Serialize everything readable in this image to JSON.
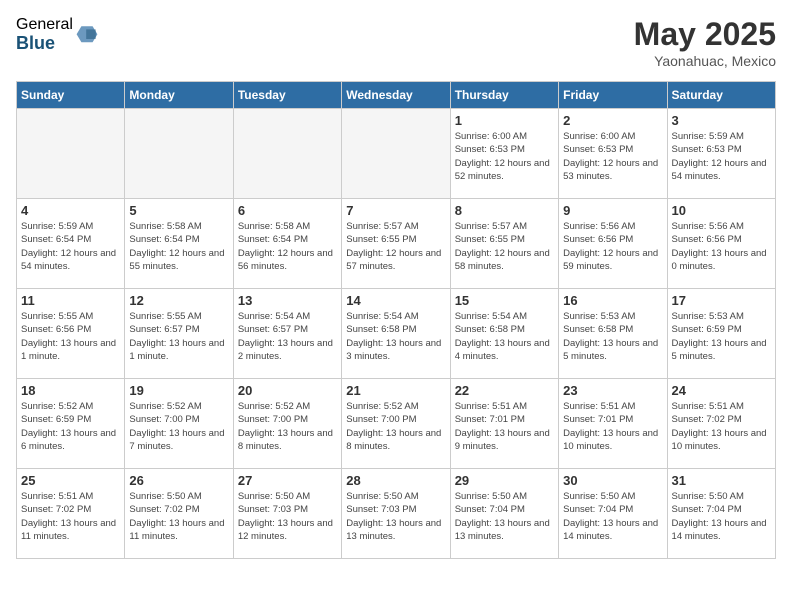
{
  "header": {
    "logo_general": "General",
    "logo_blue": "Blue",
    "month_title": "May 2025",
    "location": "Yaonahuac, Mexico"
  },
  "weekdays": [
    "Sunday",
    "Monday",
    "Tuesday",
    "Wednesday",
    "Thursday",
    "Friday",
    "Saturday"
  ],
  "weeks": [
    [
      {
        "day": "",
        "info": "",
        "empty": true
      },
      {
        "day": "",
        "info": "",
        "empty": true
      },
      {
        "day": "",
        "info": "",
        "empty": true
      },
      {
        "day": "",
        "info": "",
        "empty": true
      },
      {
        "day": "1",
        "info": "Sunrise: 6:00 AM\nSunset: 6:53 PM\nDaylight: 12 hours\nand 52 minutes."
      },
      {
        "day": "2",
        "info": "Sunrise: 6:00 AM\nSunset: 6:53 PM\nDaylight: 12 hours\nand 53 minutes."
      },
      {
        "day": "3",
        "info": "Sunrise: 5:59 AM\nSunset: 6:53 PM\nDaylight: 12 hours\nand 54 minutes."
      }
    ],
    [
      {
        "day": "4",
        "info": "Sunrise: 5:59 AM\nSunset: 6:54 PM\nDaylight: 12 hours\nand 54 minutes."
      },
      {
        "day": "5",
        "info": "Sunrise: 5:58 AM\nSunset: 6:54 PM\nDaylight: 12 hours\nand 55 minutes."
      },
      {
        "day": "6",
        "info": "Sunrise: 5:58 AM\nSunset: 6:54 PM\nDaylight: 12 hours\nand 56 minutes."
      },
      {
        "day": "7",
        "info": "Sunrise: 5:57 AM\nSunset: 6:55 PM\nDaylight: 12 hours\nand 57 minutes."
      },
      {
        "day": "8",
        "info": "Sunrise: 5:57 AM\nSunset: 6:55 PM\nDaylight: 12 hours\nand 58 minutes."
      },
      {
        "day": "9",
        "info": "Sunrise: 5:56 AM\nSunset: 6:56 PM\nDaylight: 12 hours\nand 59 minutes."
      },
      {
        "day": "10",
        "info": "Sunrise: 5:56 AM\nSunset: 6:56 PM\nDaylight: 13 hours\nand 0 minutes."
      }
    ],
    [
      {
        "day": "11",
        "info": "Sunrise: 5:55 AM\nSunset: 6:56 PM\nDaylight: 13 hours\nand 1 minute."
      },
      {
        "day": "12",
        "info": "Sunrise: 5:55 AM\nSunset: 6:57 PM\nDaylight: 13 hours\nand 1 minute."
      },
      {
        "day": "13",
        "info": "Sunrise: 5:54 AM\nSunset: 6:57 PM\nDaylight: 13 hours\nand 2 minutes."
      },
      {
        "day": "14",
        "info": "Sunrise: 5:54 AM\nSunset: 6:58 PM\nDaylight: 13 hours\nand 3 minutes."
      },
      {
        "day": "15",
        "info": "Sunrise: 5:54 AM\nSunset: 6:58 PM\nDaylight: 13 hours\nand 4 minutes."
      },
      {
        "day": "16",
        "info": "Sunrise: 5:53 AM\nSunset: 6:58 PM\nDaylight: 13 hours\nand 5 minutes."
      },
      {
        "day": "17",
        "info": "Sunrise: 5:53 AM\nSunset: 6:59 PM\nDaylight: 13 hours\nand 5 minutes."
      }
    ],
    [
      {
        "day": "18",
        "info": "Sunrise: 5:52 AM\nSunset: 6:59 PM\nDaylight: 13 hours\nand 6 minutes."
      },
      {
        "day": "19",
        "info": "Sunrise: 5:52 AM\nSunset: 7:00 PM\nDaylight: 13 hours\nand 7 minutes."
      },
      {
        "day": "20",
        "info": "Sunrise: 5:52 AM\nSunset: 7:00 PM\nDaylight: 13 hours\nand 8 minutes."
      },
      {
        "day": "21",
        "info": "Sunrise: 5:52 AM\nSunset: 7:00 PM\nDaylight: 13 hours\nand 8 minutes."
      },
      {
        "day": "22",
        "info": "Sunrise: 5:51 AM\nSunset: 7:01 PM\nDaylight: 13 hours\nand 9 minutes."
      },
      {
        "day": "23",
        "info": "Sunrise: 5:51 AM\nSunset: 7:01 PM\nDaylight: 13 hours\nand 10 minutes."
      },
      {
        "day": "24",
        "info": "Sunrise: 5:51 AM\nSunset: 7:02 PM\nDaylight: 13 hours\nand 10 minutes."
      }
    ],
    [
      {
        "day": "25",
        "info": "Sunrise: 5:51 AM\nSunset: 7:02 PM\nDaylight: 13 hours\nand 11 minutes."
      },
      {
        "day": "26",
        "info": "Sunrise: 5:50 AM\nSunset: 7:02 PM\nDaylight: 13 hours\nand 11 minutes."
      },
      {
        "day": "27",
        "info": "Sunrise: 5:50 AM\nSunset: 7:03 PM\nDaylight: 13 hours\nand 12 minutes."
      },
      {
        "day": "28",
        "info": "Sunrise: 5:50 AM\nSunset: 7:03 PM\nDaylight: 13 hours\nand 13 minutes."
      },
      {
        "day": "29",
        "info": "Sunrise: 5:50 AM\nSunset: 7:04 PM\nDaylight: 13 hours\nand 13 minutes."
      },
      {
        "day": "30",
        "info": "Sunrise: 5:50 AM\nSunset: 7:04 PM\nDaylight: 13 hours\nand 14 minutes."
      },
      {
        "day": "31",
        "info": "Sunrise: 5:50 AM\nSunset: 7:04 PM\nDaylight: 13 hours\nand 14 minutes."
      }
    ]
  ]
}
